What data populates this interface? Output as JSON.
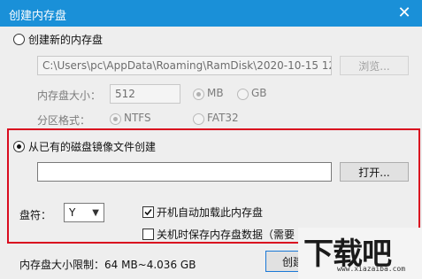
{
  "window": {
    "title": "创建内存盘",
    "close_glyph": "✕"
  },
  "new_disk": {
    "radio_label": "创建新的内存盘",
    "path_value": "C:\\Users\\pc\\AppData\\Roaming\\RamDisk\\2020-10-15 12",
    "browse_label": "浏览...",
    "size_label": "内存盘大小：",
    "size_value": "512",
    "unit_mb": "MB",
    "unit_gb": "GB",
    "fs_label": "分区格式：",
    "fs_ntfs": "NTFS",
    "fs_fat32": "FAT32"
  },
  "from_image": {
    "radio_label": "从已有的磁盘镜像文件创建",
    "path_value": "",
    "open_label": "打开...",
    "drive_label": "盘符：",
    "drive_value": "Y",
    "autoload_label": "开机自动加载此内存盘",
    "save_on_shutdown_label": "关机时保存内存盘数据（需要"
  },
  "footer": {
    "size_limit": "内存盘大小限制：64 MB~4.036 GB",
    "create_label": "创建"
  },
  "watermark": {
    "glyphs": "下载吧",
    "url": "www.xiazaiba.com"
  },
  "colors": {
    "titlebar": "#1a90d8",
    "highlight": "#d90b1f"
  }
}
